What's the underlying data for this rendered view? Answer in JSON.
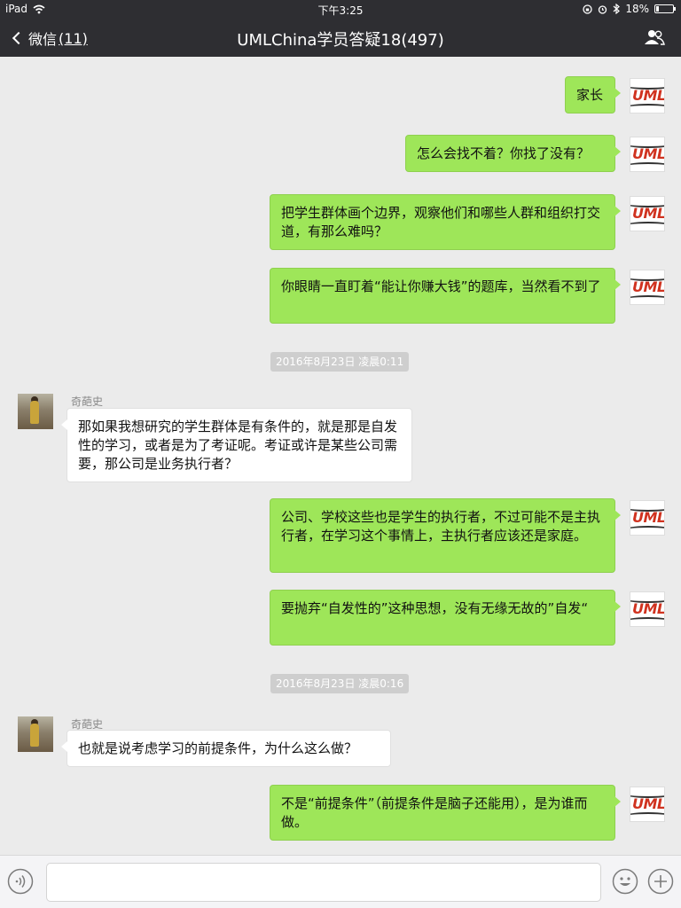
{
  "status_bar": {
    "device": "iPad",
    "time": "下午3:25",
    "battery": "18%",
    "battery_level": 0.18
  },
  "nav": {
    "back_label": "微信",
    "back_count": "(11)",
    "title": "UMLChina学员答疑18(497)"
  },
  "messages": [
    {
      "side": "right",
      "text": "家长"
    },
    {
      "side": "right",
      "text": "怎么会找不着？你找了没有？"
    },
    {
      "side": "right",
      "text": "把学生群体画个边界，观察他们和哪些人群和组织打交道，有那么难吗？"
    },
    {
      "side": "right",
      "text": "你眼睛一直盯着“能让你赚大钱”的题库，当然看不到了"
    },
    {
      "timestamp": "2016年8月23日 凌晨0:11"
    },
    {
      "side": "left",
      "sender": "奇葩史",
      "text": "那如果我想研究的学生群体是有条件的，就是那是自发性的学习，或者是为了考证呢。考证或许是某些公司需要，那公司是业务执行者？"
    },
    {
      "side": "right",
      "text": "公司、学校这些也是学生的执行者，不过可能不是主执行者，在学习这个事情上，主执行者应该还是家庭。"
    },
    {
      "side": "right",
      "text": "要抛弃“自发性的”这种思想，没有无缘无故的”自发“"
    },
    {
      "timestamp": "2016年8月23日 凌晨0:16"
    },
    {
      "side": "left",
      "sender": "奇葩史",
      "text": "也就是说考虑学习的前提条件，为什么这么做？"
    },
    {
      "side": "right",
      "text": "不是“前提条件”（前提条件是脑子还能用），是为谁而做。"
    }
  ],
  "self_avatar_logo": "UML",
  "input": {
    "placeholder": ""
  },
  "icons": {
    "wifi": "wifi-icon",
    "back": "chevron-left-icon",
    "people": "group-members-icon",
    "voice": "voice-icon",
    "emoji": "emoji-icon",
    "plus": "plus-icon"
  },
  "colors": {
    "navbar": "#2e2e32",
    "background": "#ebebeb",
    "bubble_self": "#9ee659",
    "bubble_other": "#ffffff",
    "timestamp_bg": "#cecece",
    "logo_red": "#d0321f"
  }
}
